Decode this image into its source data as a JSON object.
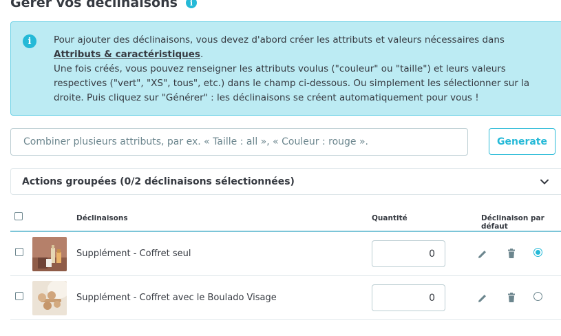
{
  "header": {
    "title": "Gérer vos déclinaisons",
    "info_icon": "info-icon"
  },
  "alert": {
    "icon": "info-icon",
    "text_before_link": "Pour ajouter des déclinaisons, vous devez d'abord créer les attributs et valeurs nécessaires dans ",
    "link_text": "Attributs & caractéristiques",
    "text_after_link": ".",
    "line2": "Une fois créés, vous pouvez renseigner les attributs voulus (\"couleur\" ou \"taille\") et leurs valeurs respectives (\"vert\", \"XS\", tous\", etc.) dans le champ ci-dessous. Ou simplement les sélectionner sur la droite. Puis cliquez sur \"Générer\" : les déclinaisons se créent automatiquement pour vous !"
  },
  "generator": {
    "input_value": "",
    "placeholder": "Combiner plusieurs attributs, par ex. « Taille : all », « Couleur : rouge ».",
    "button_label": "Generate"
  },
  "bulk_actions": {
    "label": "Actions groupées (0/2 déclinaisons sélectionnées)",
    "icon": "chevron-down-icon"
  },
  "table": {
    "headers": {
      "combination": "Déclinaisons",
      "quantity": "Quantité",
      "default": "Déclinaison par défaut"
    },
    "rows": [
      {
        "name": "Supplément - Coffret seul",
        "quantity": "0",
        "is_default": true,
        "thumbnail": "product-thumbnail-bottles"
      },
      {
        "name": "Supplément - Coffret avec le Boulado Visage",
        "quantity": "0",
        "is_default": false,
        "thumbnail": "product-thumbnail-wooden-massager"
      }
    ],
    "row_icons": [
      "edit-icon",
      "trash-icon"
    ]
  },
  "colors": {
    "accent": "#25b9d7",
    "alert_bg": "#bcebf3",
    "text": "#363a41",
    "border": "#bbcdd2"
  }
}
